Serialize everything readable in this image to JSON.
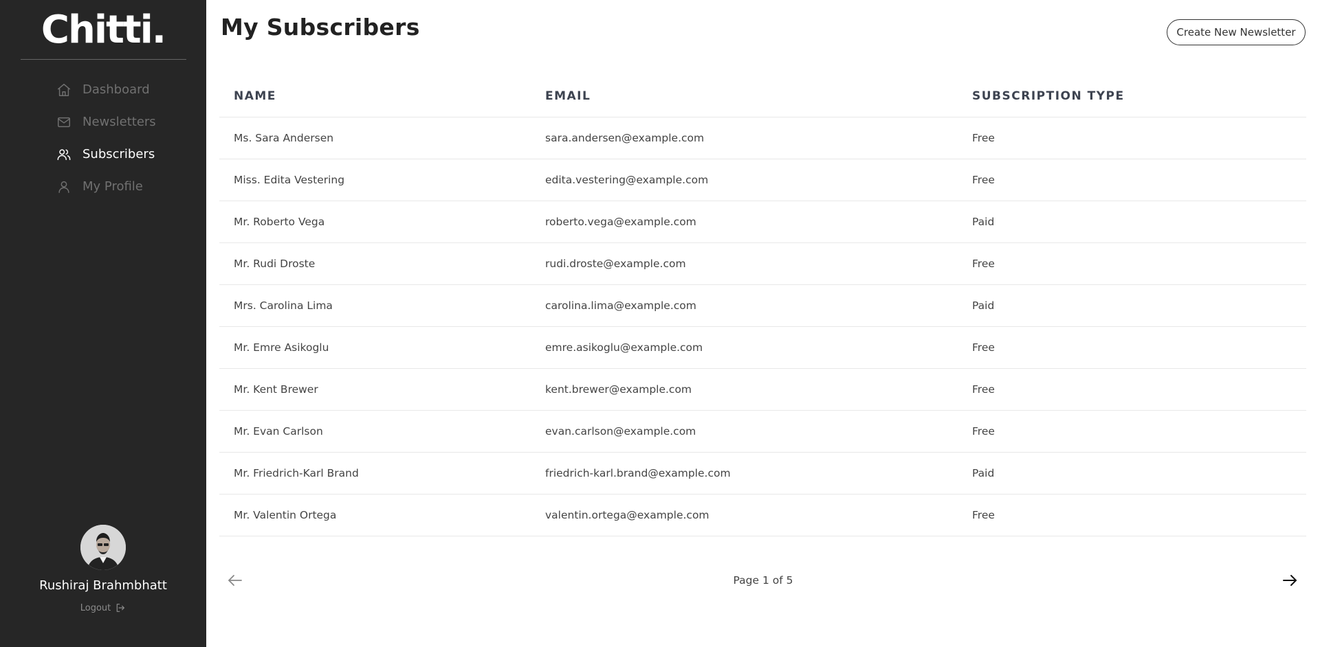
{
  "app": {
    "logo": "Chitti."
  },
  "sidebar": {
    "items": [
      {
        "label": "Dashboard",
        "icon": "home-icon"
      },
      {
        "label": "Newsletters",
        "icon": "mail-icon"
      },
      {
        "label": "Subscribers",
        "icon": "users-icon",
        "active": true
      },
      {
        "label": "My Profile",
        "icon": "user-icon"
      }
    ]
  },
  "profile": {
    "name": "Rushiraj Brahmbhatt",
    "logout_label": "Logout"
  },
  "header": {
    "title": "My Subscribers",
    "create_button": "Create New Newsletter"
  },
  "table": {
    "headers": [
      "NAME",
      "EMAIL",
      "SUBSCRIPTION TYPE"
    ],
    "rows": [
      [
        "Ms. Sara Andersen",
        "sara.andersen@example.com",
        "Free"
      ],
      [
        "Miss. Edita Vestering",
        "edita.vestering@example.com",
        "Free"
      ],
      [
        "Mr. Roberto Vega",
        "roberto.vega@example.com",
        "Paid"
      ],
      [
        "Mr. Rudi Droste",
        "rudi.droste@example.com",
        "Free"
      ],
      [
        "Mrs. Carolina Lima",
        "carolina.lima@example.com",
        "Paid"
      ],
      [
        "Mr. Emre Asikoglu",
        "emre.asikoglu@example.com",
        "Free"
      ],
      [
        "Mr. Kent Brewer",
        "kent.brewer@example.com",
        "Free"
      ],
      [
        "Mr. Evan Carlson",
        "evan.carlson@example.com",
        "Free"
      ],
      [
        "Mr. Friedrich-Karl Brand",
        "friedrich-karl.brand@example.com",
        "Paid"
      ],
      [
        "Mr. Valentin Ortega",
        "valentin.ortega@example.com",
        "Free"
      ]
    ]
  },
  "pagination": {
    "label": "Page 1 of 5"
  },
  "colors": {
    "sidebar_bg": "#262626",
    "active": "#ffffff",
    "inactive": "#707070"
  }
}
